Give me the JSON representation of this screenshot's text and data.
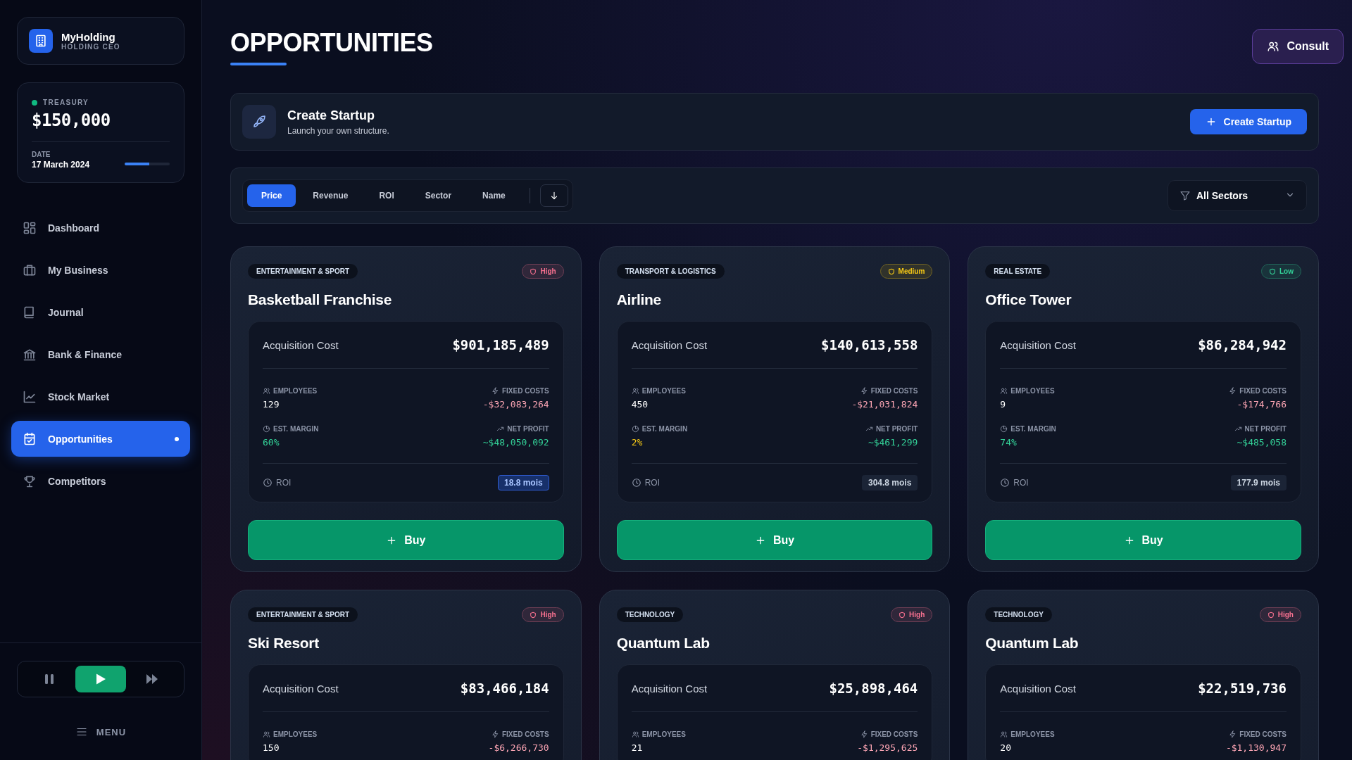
{
  "brand": {
    "name": "MyHolding",
    "subtitle": "HOLDING CEO"
  },
  "treasury": {
    "label": "TREASURY",
    "amount": "$150,000",
    "date_label": "DATE",
    "date": "17 March 2024",
    "progress": {
      "level": 0.55
    }
  },
  "nav": [
    {
      "kind": "dashboard",
      "label": "Dashboard",
      "selected": false
    },
    {
      "kind": "business",
      "label": "My Business",
      "selected": false
    },
    {
      "kind": "journal",
      "label": "Journal",
      "selected": false
    },
    {
      "kind": "bank",
      "label": "Bank & Finance",
      "selected": false
    },
    {
      "kind": "stocks",
      "label": "Stock Market",
      "selected": false
    },
    {
      "kind": "opportunities",
      "label": "Opportunities",
      "selected": true
    },
    {
      "kind": "competitors",
      "label": "Competitors",
      "selected": false
    }
  ],
  "controls": [
    {
      "kind": "pause",
      "selected": false
    },
    {
      "kind": "play",
      "selected": true
    },
    {
      "kind": "fast-forward",
      "selected": false
    }
  ],
  "menu_label": "MENU",
  "page_title": "OPPORTUNITIES",
  "consult_button": "Consult",
  "startup": {
    "title": "Create Startup",
    "subtitle": "Launch your own structure.",
    "button": "Create Startup"
  },
  "sort_tabs": [
    {
      "label": "Price",
      "selected": true
    },
    {
      "label": "Revenue",
      "selected": false
    },
    {
      "label": "ROI",
      "selected": false
    },
    {
      "label": "Sector",
      "selected": false
    },
    {
      "label": "Name",
      "selected": false
    }
  ],
  "sector_filter": {
    "value": "All Sectors"
  },
  "cards": [
    {
      "sector": "ENTERTAINMENT & SPORT",
      "title": "Basketball Franchise",
      "risk": {
        "label": "High",
        "color": "#f87190"
      },
      "cost_label": "Acquisition Cost",
      "cost": "$901,185,489",
      "stats": [
        {
          "kind": "employees",
          "label": "EMPLOYEES",
          "value": "129"
        },
        {
          "kind": "fixed_costs",
          "label": "FIXED COSTS",
          "value": "-$32,083,264"
        },
        {
          "kind": "margin",
          "label": "EST. MARGIN",
          "value": "60%",
          "color": "#34d399"
        },
        {
          "kind": "net_profit",
          "label": "NET PROFIT",
          "value": "~$48,050,092"
        }
      ],
      "roi": {
        "label": "ROI",
        "value": "18.8 mois",
        "highlighted": true
      },
      "buy_label": "Buy"
    },
    {
      "sector": "TRANSPORT & LOGISTICS",
      "title": "Airline",
      "risk": {
        "label": "Medium",
        "color": "#facc15"
      },
      "cost_label": "Acquisition Cost",
      "cost": "$140,613,558",
      "stats": [
        {
          "kind": "employees",
          "label": "EMPLOYEES",
          "value": "450"
        },
        {
          "kind": "fixed_costs",
          "label": "FIXED COSTS",
          "value": "-$21,031,824"
        },
        {
          "kind": "margin",
          "label": "EST. MARGIN",
          "value": "2%",
          "color": "#facc15"
        },
        {
          "kind": "net_profit",
          "label": "NET PROFIT",
          "value": "~$461,299"
        }
      ],
      "roi": {
        "label": "ROI",
        "value": "304.8 mois",
        "highlighted": false
      },
      "buy_label": "Buy"
    },
    {
      "sector": "REAL ESTATE",
      "title": "Office Tower",
      "risk": {
        "label": "Low",
        "color": "#34d399"
      },
      "cost_label": "Acquisition Cost",
      "cost": "$86,284,942",
      "stats": [
        {
          "kind": "employees",
          "label": "EMPLOYEES",
          "value": "9"
        },
        {
          "kind": "fixed_costs",
          "label": "FIXED COSTS",
          "value": "-$174,766"
        },
        {
          "kind": "margin",
          "label": "EST. MARGIN",
          "value": "74%",
          "color": "#34d399"
        },
        {
          "kind": "net_profit",
          "label": "NET PROFIT",
          "value": "~$485,058"
        }
      ],
      "roi": {
        "label": "ROI",
        "value": "177.9 mois",
        "highlighted": false
      },
      "buy_label": "Buy"
    },
    {
      "sector": "ENTERTAINMENT & SPORT",
      "title": "Ski Resort",
      "risk": {
        "label": "High",
        "color": "#f87190"
      },
      "cost_label": "Acquisition Cost",
      "cost": "$83,466,184",
      "stats": [
        {
          "kind": "employees",
          "label": "EMPLOYEES",
          "value": "150"
        },
        {
          "kind": "fixed_costs",
          "label": "FIXED COSTS",
          "value": "-$6,266,730"
        }
      ]
    },
    {
      "sector": "TECHNOLOGY",
      "title": "Quantum Lab",
      "risk": {
        "label": "High",
        "color": "#f87190"
      },
      "cost_label": "Acquisition Cost",
      "cost": "$25,898,464",
      "stats": [
        {
          "kind": "employees",
          "label": "EMPLOYEES",
          "value": "21"
        },
        {
          "kind": "fixed_costs",
          "label": "FIXED COSTS",
          "value": "-$1,295,625"
        }
      ]
    },
    {
      "sector": "TECHNOLOGY",
      "title": "Quantum Lab",
      "risk": {
        "label": "High",
        "color": "#f87190"
      },
      "cost_label": "Acquisition Cost",
      "cost": "$22,519,736",
      "stats": [
        {
          "kind": "employees",
          "label": "EMPLOYEES",
          "value": "20"
        },
        {
          "kind": "fixed_costs",
          "label": "FIXED COSTS",
          "value": "-$1,130,947"
        }
      ]
    }
  ]
}
